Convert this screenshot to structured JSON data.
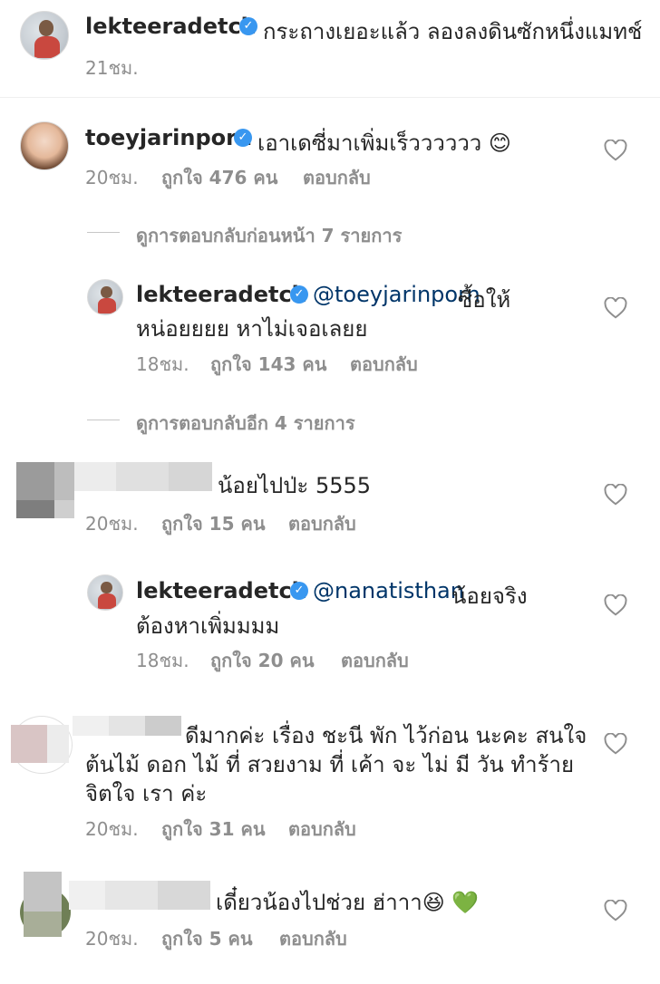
{
  "post": {
    "username": "lekteeradetch",
    "caption": "กระถางเยอะแล้ว ลองลงดินซักหนึ่งแมทช์",
    "time": "21ชม."
  },
  "comments": [
    {
      "username": "toeyjarinporn",
      "text": "เอาเดซี่มาเพิ่มเร็วววววว 😊",
      "time": "20ชม.",
      "likes": "ถูกใจ 476 คน",
      "reply": "ตอบกลับ",
      "view_previous": "ดูการตอบกลับก่อนหน้า 7 รายการ",
      "replies": [
        {
          "username": "lekteeradetch",
          "mention": "@toeyjarinporn",
          "text_line1": " ซื้อให้",
          "text_line2": "หน่อยยยย หาไม่เจอเลยย",
          "time": "18ชม.",
          "likes": "ถูกใจ 143 คน",
          "reply": "ตอบกลับ"
        }
      ],
      "view_more": "ดูการตอบกลับอีก 4 รายการ"
    },
    {
      "username": "",
      "text": "น้อยไปป่ะ 5555",
      "time": "20ชม.",
      "likes": "ถูกใจ 15 คน",
      "reply": "ตอบกลับ",
      "replies": [
        {
          "username": "lekteeradetch",
          "mention": "@nanatisthan",
          "text_line1": " น้อยจริง",
          "text_line2": "ต้องหาเพิ่มมมม",
          "time": "18ชม.",
          "likes": "ถูกใจ 20 คน",
          "reply": "ตอบกลับ"
        }
      ]
    },
    {
      "username": "",
      "text_line1": "ดีมากค่ะ เรื่อง ชะนี พัก ไว้ก่อน นะคะ สนใจ",
      "text_line2": "ต้นไม้ ดอก ไม้ ที่ สวยงาม ที่ เค้า จะ ไม่ มี วัน ทำร้าย",
      "text_line3": "จิตใจ เรา ค่ะ",
      "time": "20ชม.",
      "likes": "ถูกใจ 31 คน",
      "reply": "ตอบกลับ"
    },
    {
      "username": "",
      "text": "เดี๋ยวน้องไปช่วย ฮ่าาา😆 💚",
      "time": "20ชม.",
      "likes": "ถูกใจ 5 คน",
      "reply": "ตอบกลับ"
    }
  ],
  "icons": {
    "verified": "verified-badge-icon",
    "heart": "heart-outline-icon"
  },
  "colors": {
    "verified": "#3897f0",
    "mention": "#003569",
    "meta": "#8e8e8e"
  }
}
